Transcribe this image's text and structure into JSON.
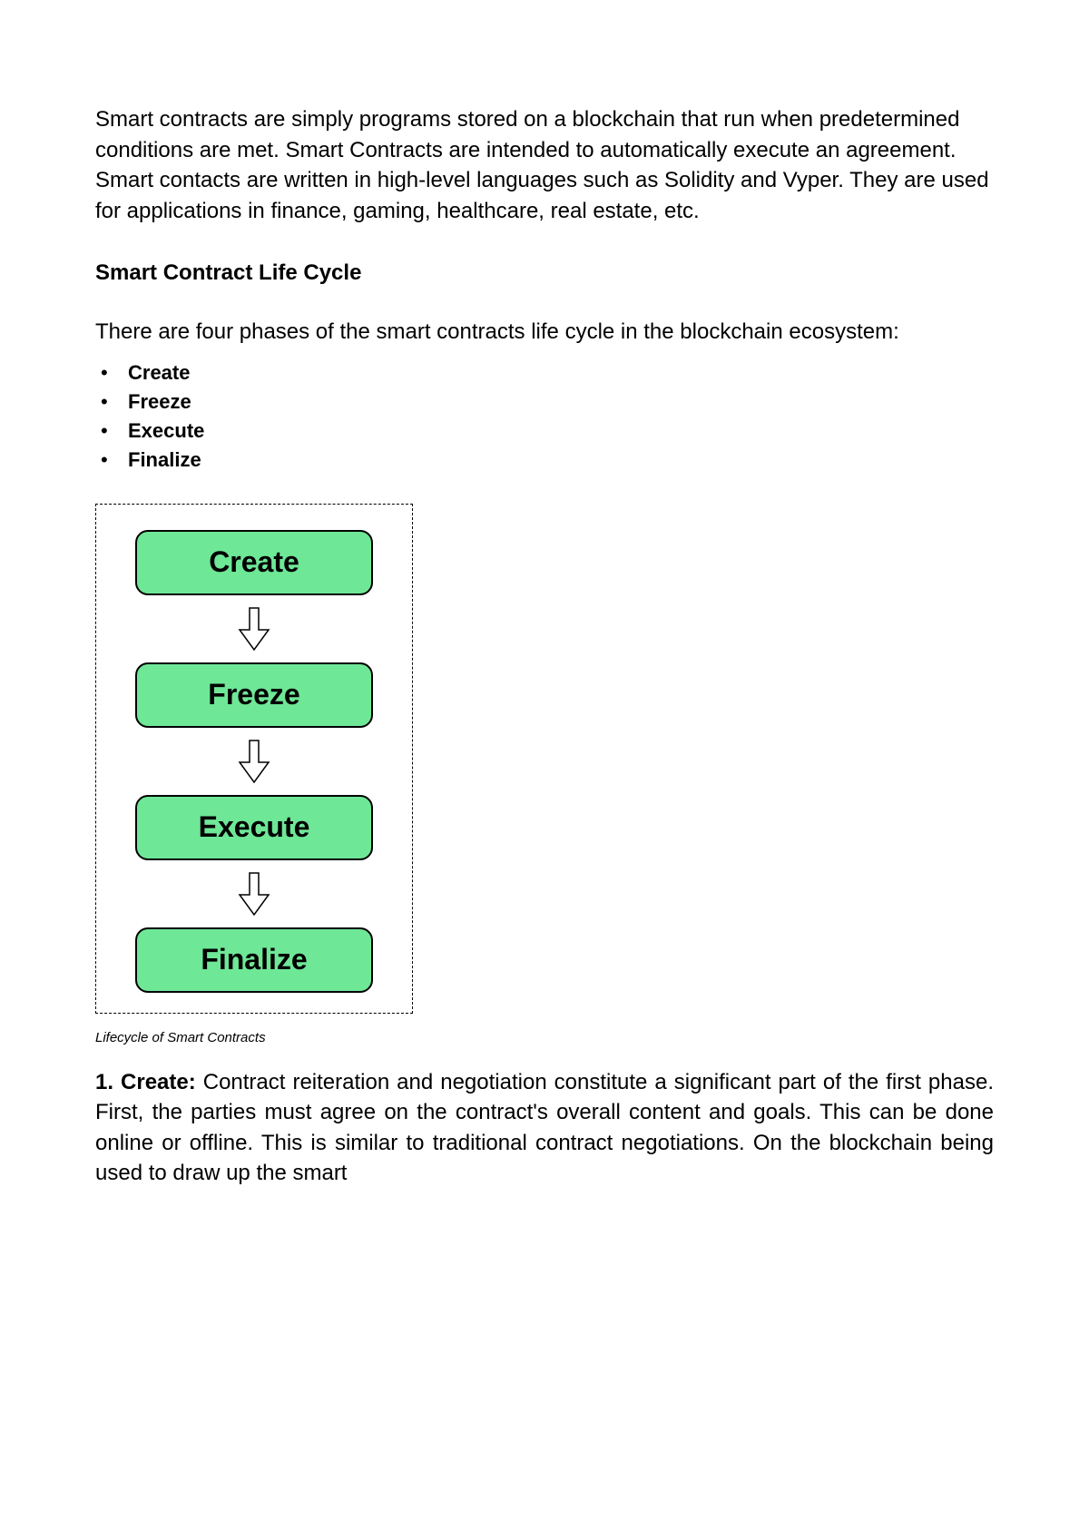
{
  "intro": "Smart contracts are simply programs stored on a blockchain that run when predetermined conditions are met. Smart Contracts are intended to automatically execute an agreement. Smart contacts are written in high-level languages such as Solidity and Vyper. They are used for applications in finance, gaming, healthcare, real estate, etc.",
  "section_heading": "Smart Contract Life Cycle",
  "phases_intro": "There are four phases of the smart contracts life cycle in the blockchain ecosystem:",
  "phases": [
    "Create",
    "Freeze",
    "Execute",
    "Finalize"
  ],
  "diagram_stages": [
    "Create",
    "Freeze",
    "Execute",
    "Finalize"
  ],
  "caption": "Lifecycle of Smart Contracts",
  "create_label": "1. Create: ",
  "create_body": "Contract reiteration and negotiation constitute a significant part of the first phase. First, the parties must agree on the contract's overall content and goals. This can be done online or offline. This is similar to traditional contract negotiations. On the blockchain being used to draw up the smart"
}
